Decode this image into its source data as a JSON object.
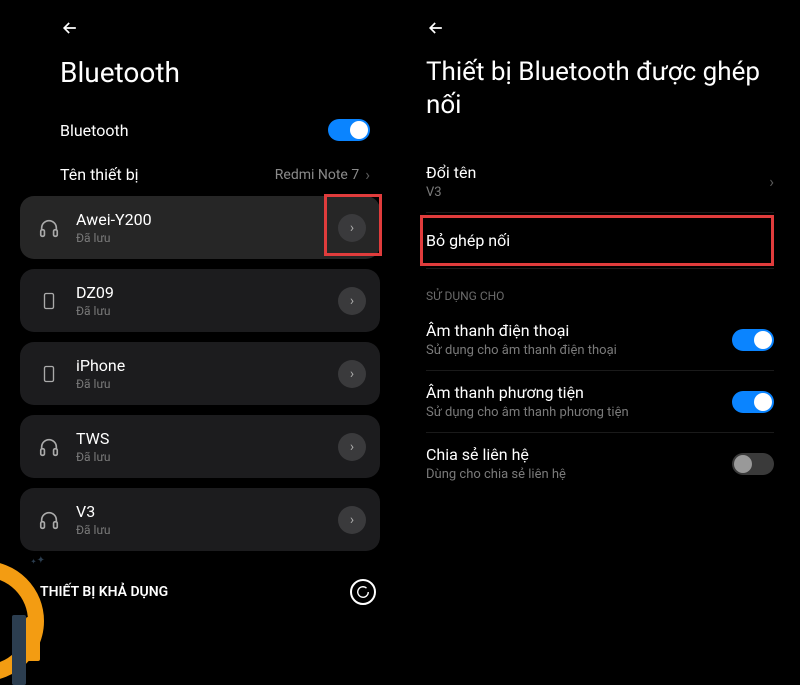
{
  "left": {
    "title": "Bluetooth",
    "bluetooth_label": "Bluetooth",
    "device_name_label": "Tên thiết bị",
    "device_name_value": "Redmi Note 7",
    "devices": [
      {
        "name": "Awei-Y200",
        "status": "Đã lưu",
        "icon": "headphones"
      },
      {
        "name": "DZ09",
        "status": "Đã lưu",
        "icon": "phone"
      },
      {
        "name": "iPhone",
        "status": "Đã lưu",
        "icon": "phone"
      },
      {
        "name": "TWS",
        "status": "Đã lưu",
        "icon": "headphones"
      },
      {
        "name": "V3",
        "status": "Đã lưu",
        "icon": "headphones"
      }
    ],
    "available_label": "THIẾT BỊ KHẢ DỤNG"
  },
  "right": {
    "title": "Thiết bị Bluetooth được ghép nối",
    "rename_label": "Đổi tên",
    "rename_value": "V3",
    "unpair_label": "Bỏ ghép nối",
    "use_for_label": "SỬ DỤNG CHO",
    "options": [
      {
        "title": "Âm thanh điện thoại",
        "sub": "Sử dụng cho âm thanh điện thoại",
        "on": true
      },
      {
        "title": "Âm thanh phương tiện",
        "sub": "Sử dụng cho âm thanh phương tiện",
        "on": true
      },
      {
        "title": "Chia sẻ liên hệ",
        "sub": "Dùng cho chia sẻ liên hệ",
        "on": false
      }
    ]
  }
}
